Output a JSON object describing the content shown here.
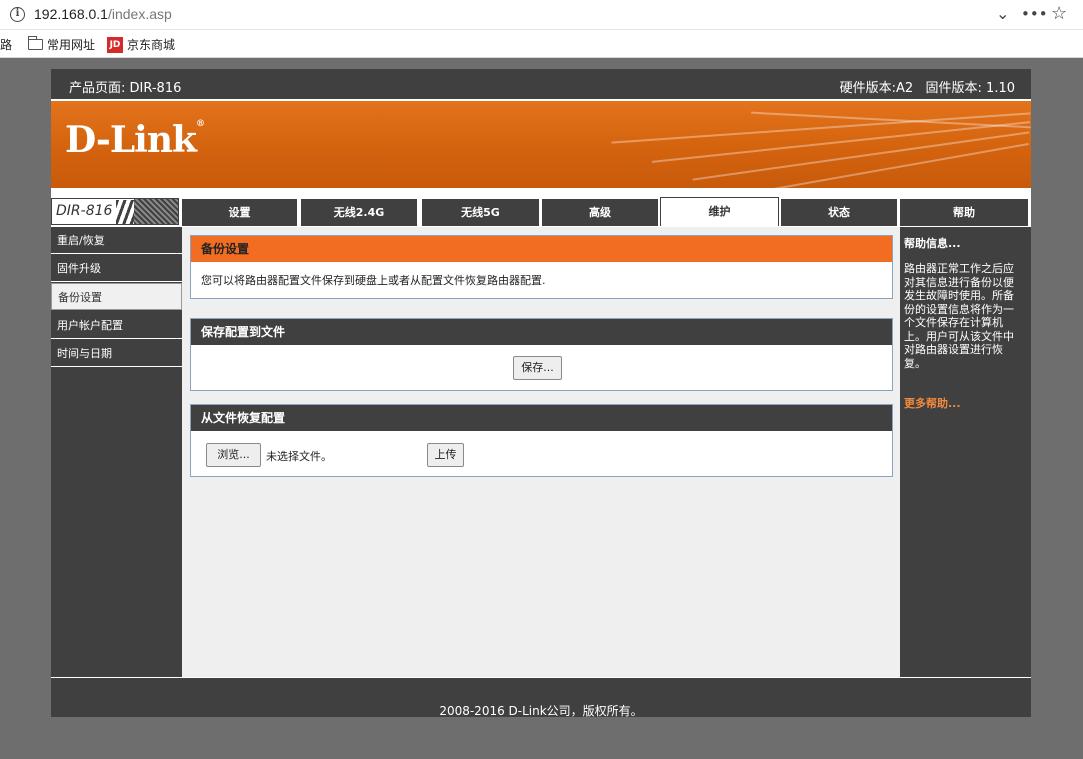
{
  "browser": {
    "url_host": "192.168.0.1",
    "url_path": "/index.asp",
    "bookmarks": [
      {
        "label": "路"
      },
      {
        "label": "常用网址"
      },
      {
        "label": "京东商城",
        "icon_text": "JD"
      }
    ]
  },
  "header": {
    "product_label": "产品页面: DIR-816",
    "version_label": "硬件版本:A2   固件版本: 1.10"
  },
  "logo": {
    "text": "D-Link",
    "mark": "®"
  },
  "model_badge": "DIR-816",
  "tabs": [
    {
      "label": "设置"
    },
    {
      "label": "无线2.4G"
    },
    {
      "label": "无线5G"
    },
    {
      "label": "高级"
    },
    {
      "label": "维护",
      "active": true
    },
    {
      "label": "状态"
    },
    {
      "label": "帮助"
    }
  ],
  "sidebar": {
    "items": [
      {
        "label": "重启/恢复"
      },
      {
        "label": "固件升级"
      },
      {
        "label": "备份设置",
        "active": true
      },
      {
        "label": "用户帐户配置"
      },
      {
        "label": "时间与日期"
      }
    ]
  },
  "backup_section": {
    "title": "备份设置",
    "description": "您可以将路由器配置文件保存到硬盘上或者从配置文件恢复路由器配置."
  },
  "save_section": {
    "title": "保存配置到文件",
    "save_button": "保存..."
  },
  "restore_section": {
    "title": "从文件恢复配置",
    "browse_button": "浏览...",
    "file_status": "未选择文件。",
    "upload_button": "上传"
  },
  "help": {
    "title": "帮助信息...",
    "body": "路由器正常工作之后应对其信息进行备份以便发生故障时使用。所备份的设置信息将作为一个文件保存在计算机上。用户可从该文件中对路由器设置进行恢复。",
    "more_link": "更多帮助..."
  },
  "footer": {
    "copyright": "2008-2016 D-Link公司，版权所有。"
  },
  "colors": {
    "dark": "#404040",
    "orange": "#f26c22",
    "link": "#f08a3e"
  }
}
